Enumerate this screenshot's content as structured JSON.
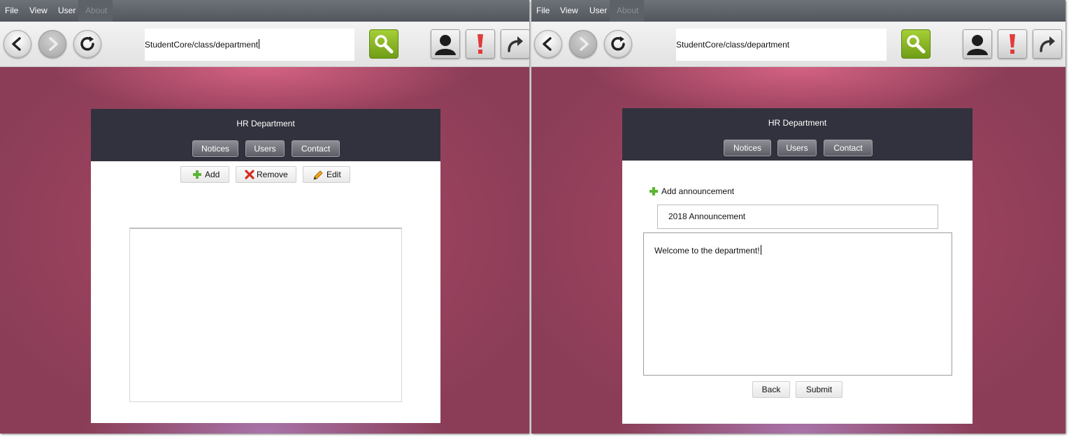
{
  "menu": {
    "items": [
      "File",
      "View",
      "User",
      "About"
    ]
  },
  "address_bar": {
    "url": "StudentCore/class/department"
  },
  "department": {
    "title": "HR Department",
    "tabs": [
      "Notices",
      "Users",
      "Contact"
    ]
  },
  "notices_view": {
    "actions": {
      "add": "Add",
      "remove": "Remove",
      "edit": "Edit"
    }
  },
  "announcement_form": {
    "add_label": "Add announcement",
    "title_value": "2018 Announcement",
    "body_value": "Welcome to the department!",
    "back_label": "Back",
    "submit_label": "Submit"
  },
  "colors": {
    "menubar": "#5f646b",
    "header": "#32323e",
    "desktop": "#8b3d57",
    "go_button": "#8fbf25",
    "alert": "#e23a3a",
    "add_icon": "#5bb533",
    "remove_icon": "#d62c1f"
  },
  "icons": [
    "back-arrow-icon",
    "forward-arrow-icon",
    "refresh-icon",
    "search-icon",
    "user-icon",
    "alert-icon",
    "share-icon",
    "plus-icon",
    "x-icon",
    "pencil-icon"
  ]
}
